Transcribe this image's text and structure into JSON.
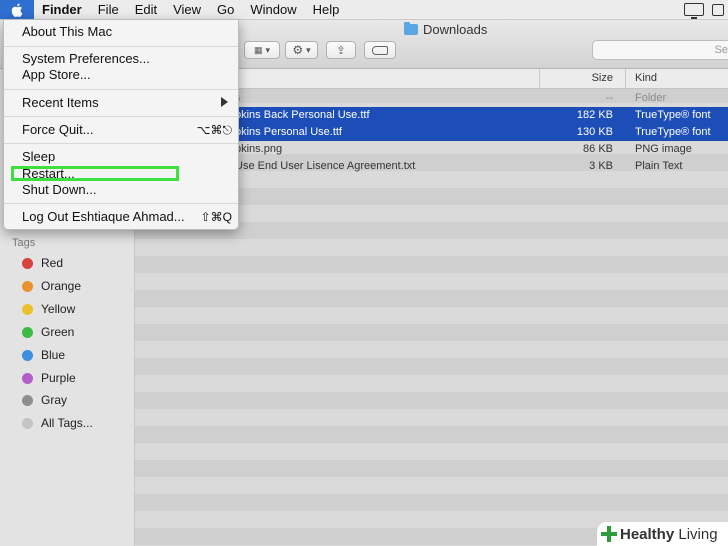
{
  "menubar": {
    "items": [
      "Finder",
      "File",
      "Edit",
      "View",
      "Go",
      "Window",
      "Help"
    ]
  },
  "window": {
    "title": "Downloads"
  },
  "search": {
    "placeholder": "Se"
  },
  "columns": {
    "size": "Size",
    "kind": "Kind"
  },
  "files": [
    {
      "name": "s",
      "size": "--",
      "kind": "Folder",
      "selected": false
    },
    {
      "name": "okins Back Personal Use.ttf",
      "size": "182 KB",
      "kind": "TrueType® font",
      "selected": true
    },
    {
      "name": "pkins Personal Use.ttf",
      "size": "130 KB",
      "kind": "TrueType® font",
      "selected": true
    },
    {
      "name": "pkins.png",
      "size": "86 KB",
      "kind": "PNG image",
      "selected": false
    },
    {
      "name": "Use End User Lisence Agreement.txt",
      "size": "3 KB",
      "kind": "Plain Text",
      "selected": false
    }
  ],
  "sidebar": {
    "tags_header": "Tags",
    "tags": [
      {
        "label": "Red",
        "color": "#d9413c"
      },
      {
        "label": "Orange",
        "color": "#e9912f"
      },
      {
        "label": "Yellow",
        "color": "#e8c12d"
      },
      {
        "label": "Green",
        "color": "#3dba45"
      },
      {
        "label": "Blue",
        "color": "#3d8fe0"
      },
      {
        "label": "Purple",
        "color": "#b15ec8"
      },
      {
        "label": "Gray",
        "color": "#8e8e8e"
      },
      {
        "label": "All Tags...",
        "color": "#c4c4c4"
      }
    ]
  },
  "apple_menu": {
    "about": "About This Mac",
    "sys_prefs": "System Preferences...",
    "app_store": "App Store...",
    "recent": "Recent Items",
    "force_quit": "Force Quit...",
    "force_quit_shortcut": "⌥⌘⎋",
    "sleep": "Sleep",
    "restart": "Restart...",
    "shutdown": "Shut Down...",
    "logout": "Log Out Eshtiaque Ahmad...",
    "logout_shortcut": "⇧⌘Q"
  },
  "watermark": {
    "word1": "Healthy",
    "word2": "Living"
  },
  "colors": {
    "selection": "#1d4eb8",
    "highlight_box": "#3ee03e",
    "apple_menu_bg": "#2f6fd0"
  }
}
